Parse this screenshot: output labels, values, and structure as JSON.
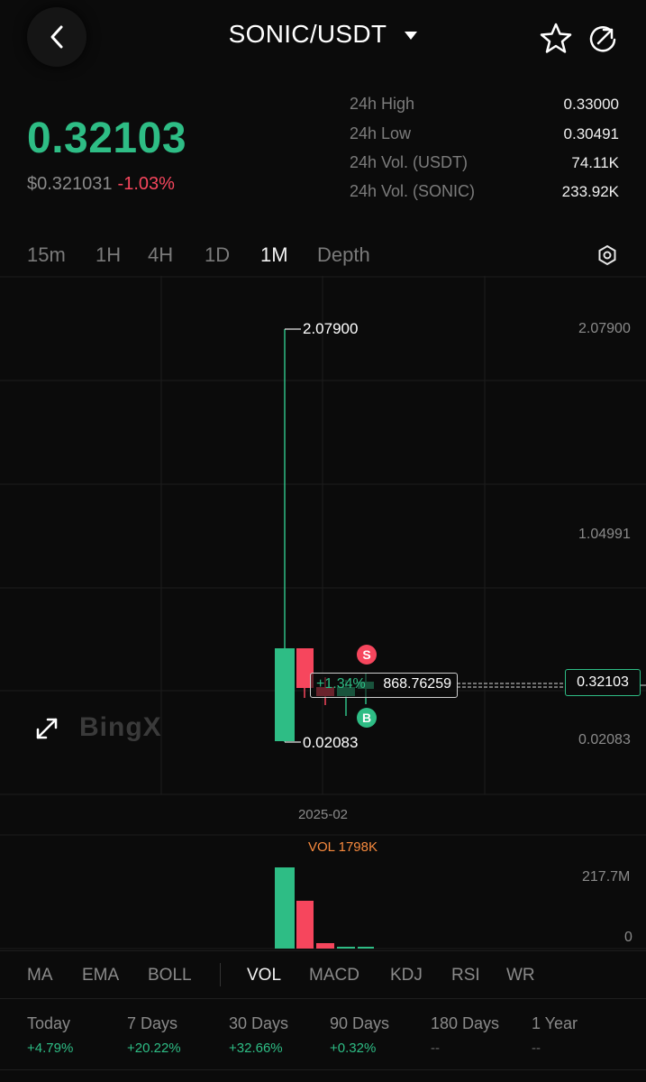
{
  "header": {
    "pair": "SONIC/USDT",
    "back_icon": "chevron-left-icon",
    "favorite_icon": "star-icon",
    "share_icon": "share-icon"
  },
  "ticker": {
    "last_price": "0.32103",
    "usd_price": "$0.321031",
    "change": "-1.03%"
  },
  "stats": [
    {
      "label": "24h High",
      "value": "0.33000"
    },
    {
      "label": "24h Low",
      "value": "0.30491"
    },
    {
      "label": "24h Vol. (USDT)",
      "value": "74.11K"
    },
    {
      "label": "24h Vol. (SONIC)",
      "value": "233.92K"
    }
  ],
  "timeframes": [
    "15m",
    "1H",
    "4H",
    "1D",
    "1M",
    "Depth"
  ],
  "active_timeframe": "1M",
  "chart": {
    "high_label": "2.07900",
    "low_label": "0.02083",
    "axis_top": "2.07900",
    "axis_mid": "1.04991",
    "axis_low": "0.02083",
    "current_price": "0.32103",
    "pct_change": "+1.34%",
    "amount": "868.76259",
    "sell_marker": "S",
    "buy_marker": "B",
    "watermark": "BingX",
    "date": "2025-02",
    "vol_title": "VOL 1798K",
    "vol_axis_top": "217.7M",
    "vol_axis_zero": "0",
    "up_color": "#2ebd85",
    "down_color": "#f6465d"
  },
  "indicators": [
    "MA",
    "EMA",
    "BOLL",
    "VOL",
    "MACD",
    "KDJ",
    "RSI",
    "WR"
  ],
  "active_indicator": "VOL",
  "performance": [
    {
      "label": "Today",
      "value": "+4.79%"
    },
    {
      "label": "7 Days",
      "value": "+20.22%"
    },
    {
      "label": "30 Days",
      "value": "+32.66%"
    },
    {
      "label": "90 Days",
      "value": "+0.32%"
    },
    {
      "label": "180 Days",
      "value": "--"
    },
    {
      "label": "1 Year",
      "value": "--"
    }
  ]
}
